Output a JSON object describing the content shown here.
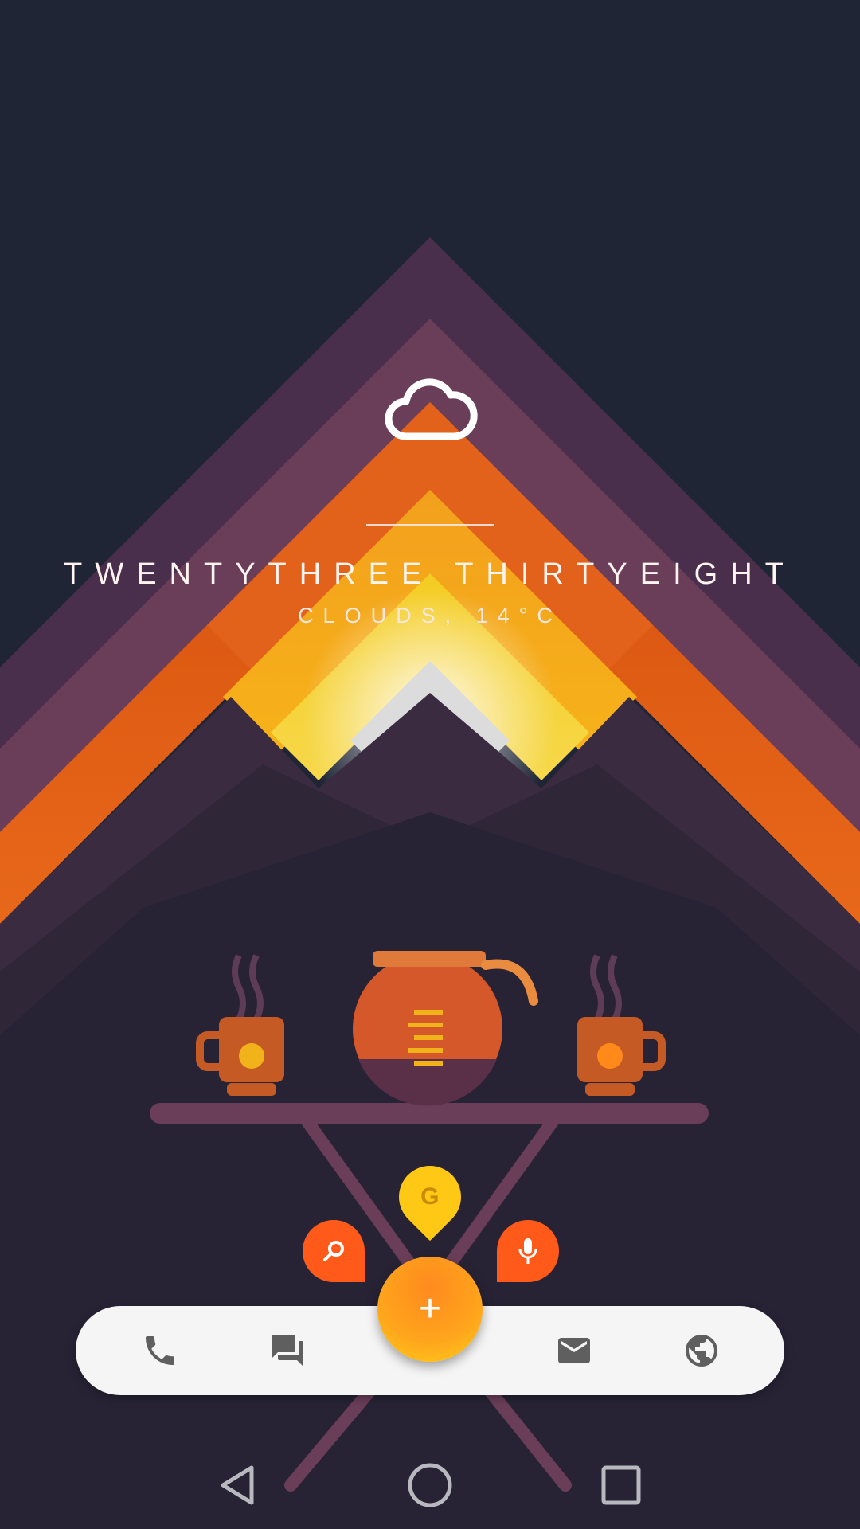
{
  "widget": {
    "time": "TWENTYTHREE  THIRTYEIGHT",
    "weather": "CLOUDS,  14°C",
    "weather_icon": "cloud-icon"
  },
  "fab": {
    "main_icon": "plus-icon",
    "main_label": "+",
    "google_label": "G",
    "search_icon": "search-icon",
    "voice_icon": "microphone-icon"
  },
  "dock": {
    "items": [
      {
        "name": "phone",
        "icon": "phone-icon"
      },
      {
        "name": "messages",
        "icon": "chat-icon"
      },
      {
        "name": "email",
        "icon": "mail-icon"
      },
      {
        "name": "browser",
        "icon": "globe-icon"
      }
    ]
  },
  "navbar": {
    "back_icon": "back-icon",
    "home_icon": "home-icon",
    "recents_icon": "recents-icon"
  },
  "colors": {
    "background": "#1f2535",
    "accent_orange": "#ff5a1a",
    "accent_yellow": "#ffc814",
    "dock": "#f5f5f5"
  }
}
